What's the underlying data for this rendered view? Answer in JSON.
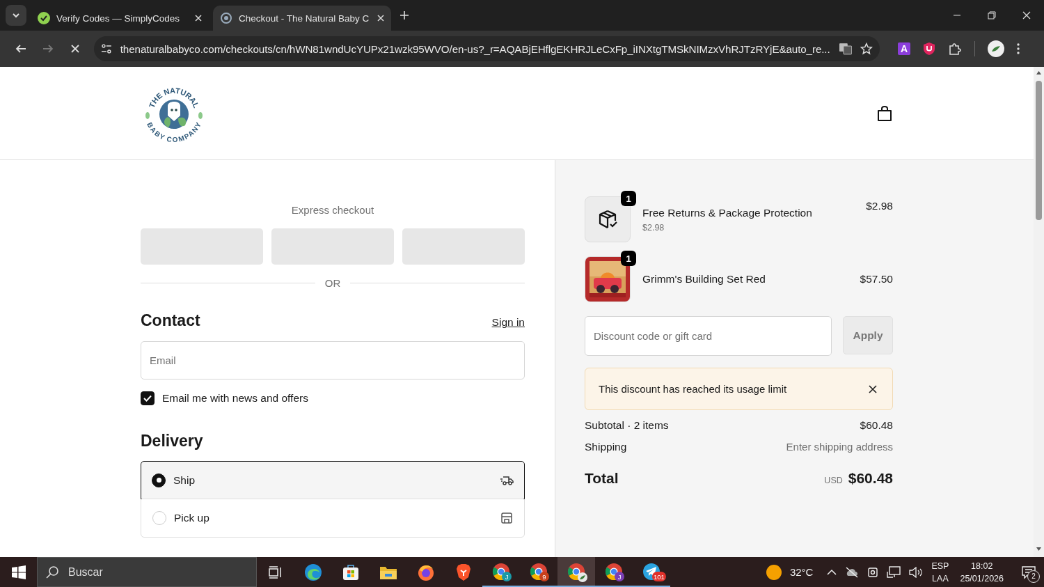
{
  "browser": {
    "tabs": [
      {
        "title": "Verify Codes — SimplyCodes",
        "selected": false,
        "kind": "coupon"
      },
      {
        "title": "Checkout - The Natural Baby C",
        "selected": true,
        "kind": "loading"
      }
    ],
    "url": "thenaturalbabyco.com/checkouts/cn/hWN81wndUcYUPx21wzk95WVO/en-us?_r=AQABjEHflgEKHRJLeCxFp_iINXtgTMSkNIMzxVhRJTzRYjE&auto_re...",
    "extensions": [
      {
        "kind": "letter",
        "label": "A"
      },
      {
        "kind": "shield"
      },
      {
        "kind": "puzzle"
      }
    ]
  },
  "header": {
    "logo_top": "THE NATURAL",
    "logo_bottom": "BABY COMPANY"
  },
  "express": {
    "label": "Express checkout",
    "divider": "OR"
  },
  "contact": {
    "heading": "Contact",
    "sign_in": "Sign in",
    "email": {
      "placeholder": "Email"
    },
    "newsletter": {
      "label": "Email me with news and offers",
      "checked": true
    }
  },
  "delivery": {
    "heading": "Delivery",
    "options": [
      {
        "label": "Ship",
        "selected": true,
        "kind": "ship"
      },
      {
        "label": "Pick up",
        "selected": false,
        "kind": "pickup"
      }
    ]
  },
  "summary": {
    "items": [
      {
        "name": "Free Returns & Package Protection",
        "unit_price": "$2.98",
        "price": "$2.98",
        "quantity": "1",
        "kind": "protection"
      },
      {
        "name": "Grimm's Building Set Red",
        "price": "$57.50",
        "quantity": "1",
        "kind": "picture"
      }
    ],
    "discount": {
      "placeholder": "Discount code or gift card",
      "button": "Apply"
    },
    "notice": "This discount has reached its usage limit",
    "rows": [
      {
        "label": "Subtotal · 2 items",
        "value": "$60.48"
      },
      {
        "label": "Shipping",
        "value": "Enter shipping address"
      }
    ],
    "total": {
      "label": "Total",
      "currency": "USD",
      "value": "$60.48"
    }
  },
  "taskbar": {
    "search": "Buscar",
    "apps": [
      {
        "kind": "taskview",
        "running": false,
        "selected": false
      },
      {
        "kind": "edge",
        "running": false,
        "selected": false
      },
      {
        "kind": "store",
        "running": false,
        "selected": false
      },
      {
        "kind": "folder",
        "running": false,
        "selected": false
      },
      {
        "kind": "firefox",
        "running": false,
        "selected": false
      },
      {
        "kind": "brave",
        "running": false,
        "selected": false
      },
      {
        "kind": "chrome",
        "badge": "J",
        "color": "#1a9aa8",
        "running": true,
        "selected": false
      },
      {
        "kind": "chrome",
        "badge": "9",
        "color": "#c8401c",
        "running": true,
        "selected": false
      },
      {
        "kind": "chrome",
        "avatar": true,
        "running": true,
        "selected": true
      },
      {
        "kind": "chrome",
        "badge": "J",
        "color": "#7b3fb5",
        "running": true,
        "selected": false
      },
      {
        "kind": "telegram",
        "badge": "101",
        "color": "#e0302a",
        "running": true,
        "selected": false
      }
    ],
    "temperature": "32°C",
    "language": "ESP",
    "layout": "LAA",
    "time": "18:02",
    "date": "25/01/2026",
    "notifications": "2"
  }
}
